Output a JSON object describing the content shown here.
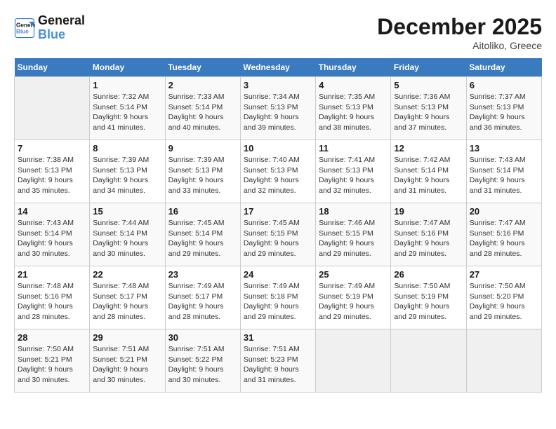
{
  "logo": {
    "line1": "General",
    "line2": "Blue"
  },
  "title": "December 2025",
  "location": "Aitoliko, Greece",
  "days_of_week": [
    "Sunday",
    "Monday",
    "Tuesday",
    "Wednesday",
    "Thursday",
    "Friday",
    "Saturday"
  ],
  "weeks": [
    [
      {
        "day": "",
        "empty": true
      },
      {
        "day": "1",
        "sunrise": "Sunrise: 7:32 AM",
        "sunset": "Sunset: 5:14 PM",
        "daylight": "Daylight: 9 hours and 41 minutes."
      },
      {
        "day": "2",
        "sunrise": "Sunrise: 7:33 AM",
        "sunset": "Sunset: 5:14 PM",
        "daylight": "Daylight: 9 hours and 40 minutes."
      },
      {
        "day": "3",
        "sunrise": "Sunrise: 7:34 AM",
        "sunset": "Sunset: 5:13 PM",
        "daylight": "Daylight: 9 hours and 39 minutes."
      },
      {
        "day": "4",
        "sunrise": "Sunrise: 7:35 AM",
        "sunset": "Sunset: 5:13 PM",
        "daylight": "Daylight: 9 hours and 38 minutes."
      },
      {
        "day": "5",
        "sunrise": "Sunrise: 7:36 AM",
        "sunset": "Sunset: 5:13 PM",
        "daylight": "Daylight: 9 hours and 37 minutes."
      },
      {
        "day": "6",
        "sunrise": "Sunrise: 7:37 AM",
        "sunset": "Sunset: 5:13 PM",
        "daylight": "Daylight: 9 hours and 36 minutes."
      }
    ],
    [
      {
        "day": "7",
        "sunrise": "Sunrise: 7:38 AM",
        "sunset": "Sunset: 5:13 PM",
        "daylight": "Daylight: 9 hours and 35 minutes."
      },
      {
        "day": "8",
        "sunrise": "Sunrise: 7:39 AM",
        "sunset": "Sunset: 5:13 PM",
        "daylight": "Daylight: 9 hours and 34 minutes."
      },
      {
        "day": "9",
        "sunrise": "Sunrise: 7:39 AM",
        "sunset": "Sunset: 5:13 PM",
        "daylight": "Daylight: 9 hours and 33 minutes."
      },
      {
        "day": "10",
        "sunrise": "Sunrise: 7:40 AM",
        "sunset": "Sunset: 5:13 PM",
        "daylight": "Daylight: 9 hours and 32 minutes."
      },
      {
        "day": "11",
        "sunrise": "Sunrise: 7:41 AM",
        "sunset": "Sunset: 5:13 PM",
        "daylight": "Daylight: 9 hours and 32 minutes."
      },
      {
        "day": "12",
        "sunrise": "Sunrise: 7:42 AM",
        "sunset": "Sunset: 5:14 PM",
        "daylight": "Daylight: 9 hours and 31 minutes."
      },
      {
        "day": "13",
        "sunrise": "Sunrise: 7:43 AM",
        "sunset": "Sunset: 5:14 PM",
        "daylight": "Daylight: 9 hours and 31 minutes."
      }
    ],
    [
      {
        "day": "14",
        "sunrise": "Sunrise: 7:43 AM",
        "sunset": "Sunset: 5:14 PM",
        "daylight": "Daylight: 9 hours and 30 minutes."
      },
      {
        "day": "15",
        "sunrise": "Sunrise: 7:44 AM",
        "sunset": "Sunset: 5:14 PM",
        "daylight": "Daylight: 9 hours and 30 minutes."
      },
      {
        "day": "16",
        "sunrise": "Sunrise: 7:45 AM",
        "sunset": "Sunset: 5:14 PM",
        "daylight": "Daylight: 9 hours and 29 minutes."
      },
      {
        "day": "17",
        "sunrise": "Sunrise: 7:45 AM",
        "sunset": "Sunset: 5:15 PM",
        "daylight": "Daylight: 9 hours and 29 minutes."
      },
      {
        "day": "18",
        "sunrise": "Sunrise: 7:46 AM",
        "sunset": "Sunset: 5:15 PM",
        "daylight": "Daylight: 9 hours and 29 minutes."
      },
      {
        "day": "19",
        "sunrise": "Sunrise: 7:47 AM",
        "sunset": "Sunset: 5:16 PM",
        "daylight": "Daylight: 9 hours and 29 minutes."
      },
      {
        "day": "20",
        "sunrise": "Sunrise: 7:47 AM",
        "sunset": "Sunset: 5:16 PM",
        "daylight": "Daylight: 9 hours and 28 minutes."
      }
    ],
    [
      {
        "day": "21",
        "sunrise": "Sunrise: 7:48 AM",
        "sunset": "Sunset: 5:16 PM",
        "daylight": "Daylight: 9 hours and 28 minutes."
      },
      {
        "day": "22",
        "sunrise": "Sunrise: 7:48 AM",
        "sunset": "Sunset: 5:17 PM",
        "daylight": "Daylight: 9 hours and 28 minutes."
      },
      {
        "day": "23",
        "sunrise": "Sunrise: 7:49 AM",
        "sunset": "Sunset: 5:17 PM",
        "daylight": "Daylight: 9 hours and 28 minutes."
      },
      {
        "day": "24",
        "sunrise": "Sunrise: 7:49 AM",
        "sunset": "Sunset: 5:18 PM",
        "daylight": "Daylight: 9 hours and 29 minutes."
      },
      {
        "day": "25",
        "sunrise": "Sunrise: 7:49 AM",
        "sunset": "Sunset: 5:19 PM",
        "daylight": "Daylight: 9 hours and 29 minutes."
      },
      {
        "day": "26",
        "sunrise": "Sunrise: 7:50 AM",
        "sunset": "Sunset: 5:19 PM",
        "daylight": "Daylight: 9 hours and 29 minutes."
      },
      {
        "day": "27",
        "sunrise": "Sunrise: 7:50 AM",
        "sunset": "Sunset: 5:20 PM",
        "daylight": "Daylight: 9 hours and 29 minutes."
      }
    ],
    [
      {
        "day": "28",
        "sunrise": "Sunrise: 7:50 AM",
        "sunset": "Sunset: 5:21 PM",
        "daylight": "Daylight: 9 hours and 30 minutes."
      },
      {
        "day": "29",
        "sunrise": "Sunrise: 7:51 AM",
        "sunset": "Sunset: 5:21 PM",
        "daylight": "Daylight: 9 hours and 30 minutes."
      },
      {
        "day": "30",
        "sunrise": "Sunrise: 7:51 AM",
        "sunset": "Sunset: 5:22 PM",
        "daylight": "Daylight: 9 hours and 30 minutes."
      },
      {
        "day": "31",
        "sunrise": "Sunrise: 7:51 AM",
        "sunset": "Sunset: 5:23 PM",
        "daylight": "Daylight: 9 hours and 31 minutes."
      },
      {
        "day": "",
        "empty": true
      },
      {
        "day": "",
        "empty": true
      },
      {
        "day": "",
        "empty": true
      }
    ]
  ]
}
